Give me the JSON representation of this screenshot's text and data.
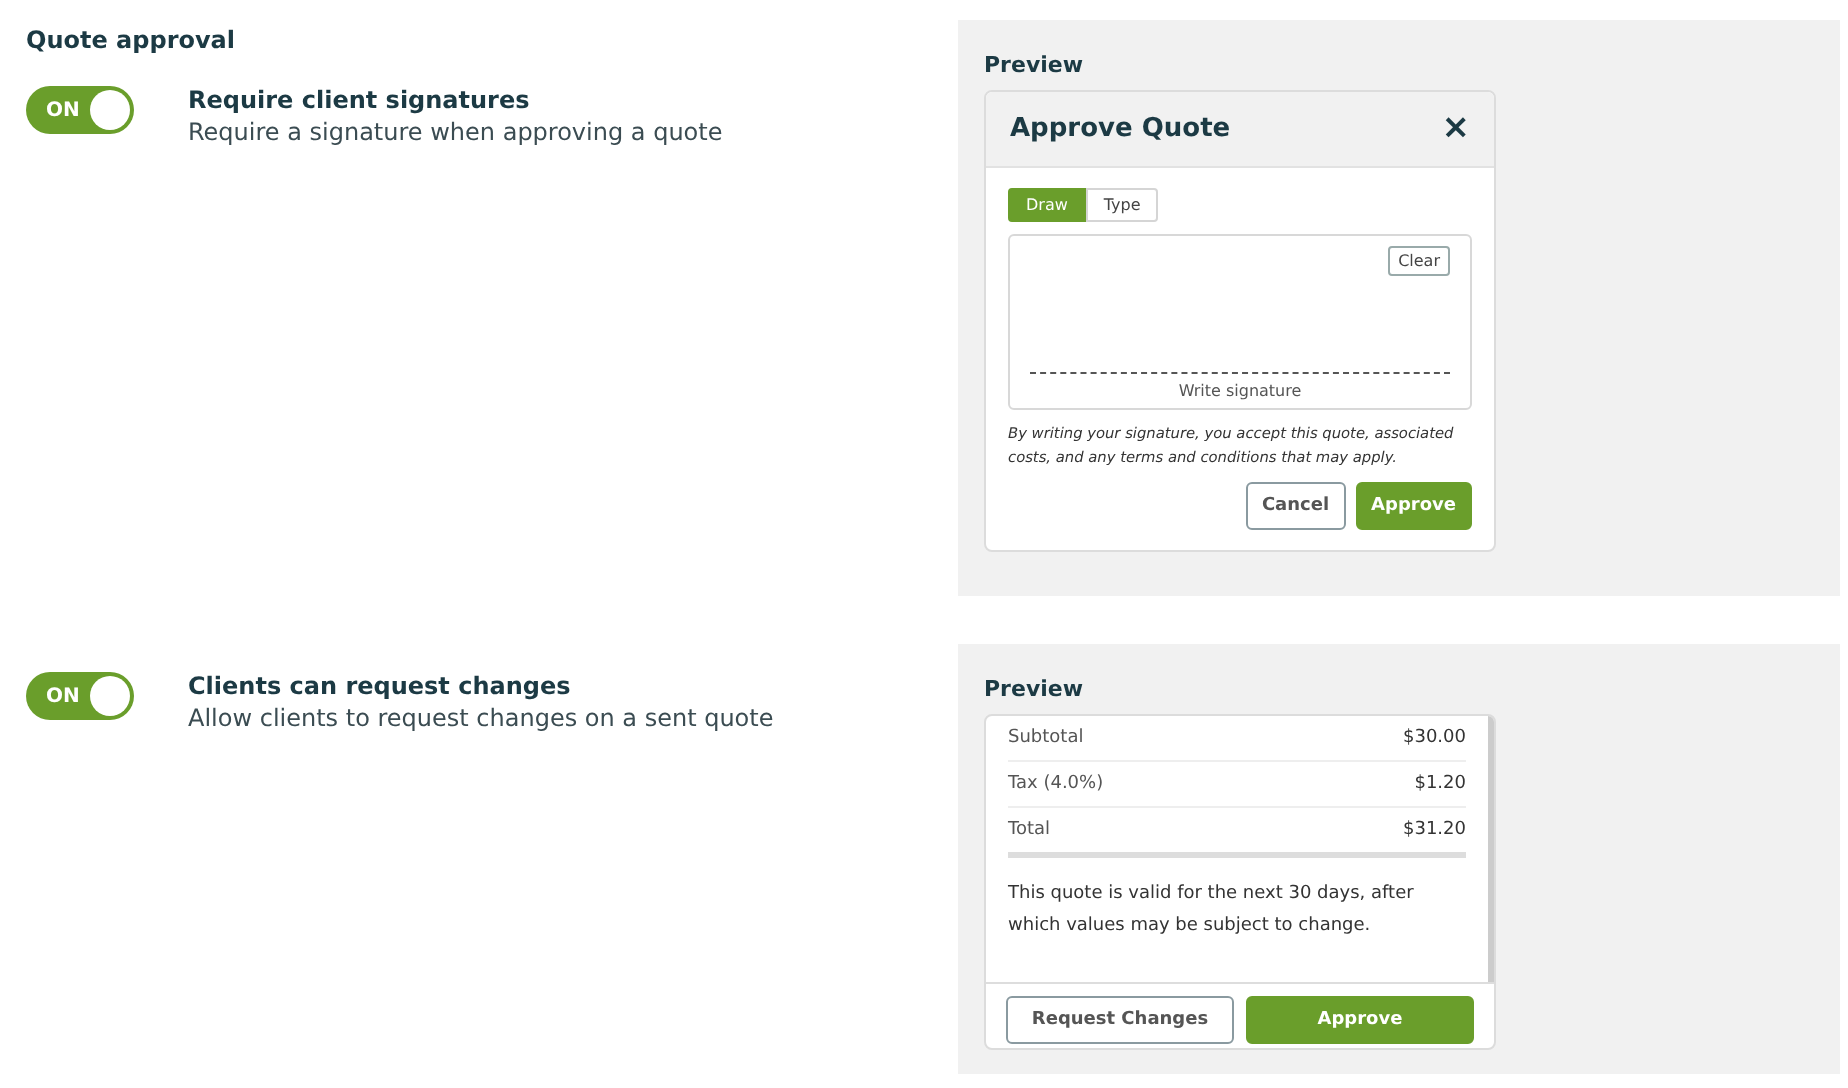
{
  "heading": "Quote approval",
  "settings": [
    {
      "toggle": {
        "label": "ON",
        "on": true
      },
      "title": "Require client signatures",
      "description": "Require a signature when approving a quote",
      "preview": {
        "kind": "signature",
        "title": "Preview",
        "dialog_title": "Approve Quote",
        "close": "×",
        "tabs": [
          {
            "label": "Draw",
            "selected": true
          },
          {
            "label": "Type",
            "selected": false
          }
        ],
        "clear": "Clear",
        "line_label": "Write signature",
        "disclaimer": "By writing your signature, you accept this quote, associated costs, and any terms and conditions that may apply.",
        "buttons": [
          "Cancel",
          "Approve"
        ]
      }
    },
    {
      "toggle": {
        "label": "ON",
        "on": true
      },
      "title": "Clients can request changes",
      "description": "Allow clients to request changes on a sent quote",
      "preview": {
        "kind": "summary",
        "title": "Preview",
        "rows": [
          {
            "label": "Subtotal",
            "value": "$30.00"
          },
          {
            "label": "Tax (4.0%)",
            "value": "$1.20"
          },
          {
            "label": "Total",
            "value": "$31.20"
          }
        ],
        "note": "This quote is valid for the next 30 days, after which values may be subject to change.",
        "buttons": [
          "Request Changes",
          "Approve"
        ]
      }
    }
  ]
}
